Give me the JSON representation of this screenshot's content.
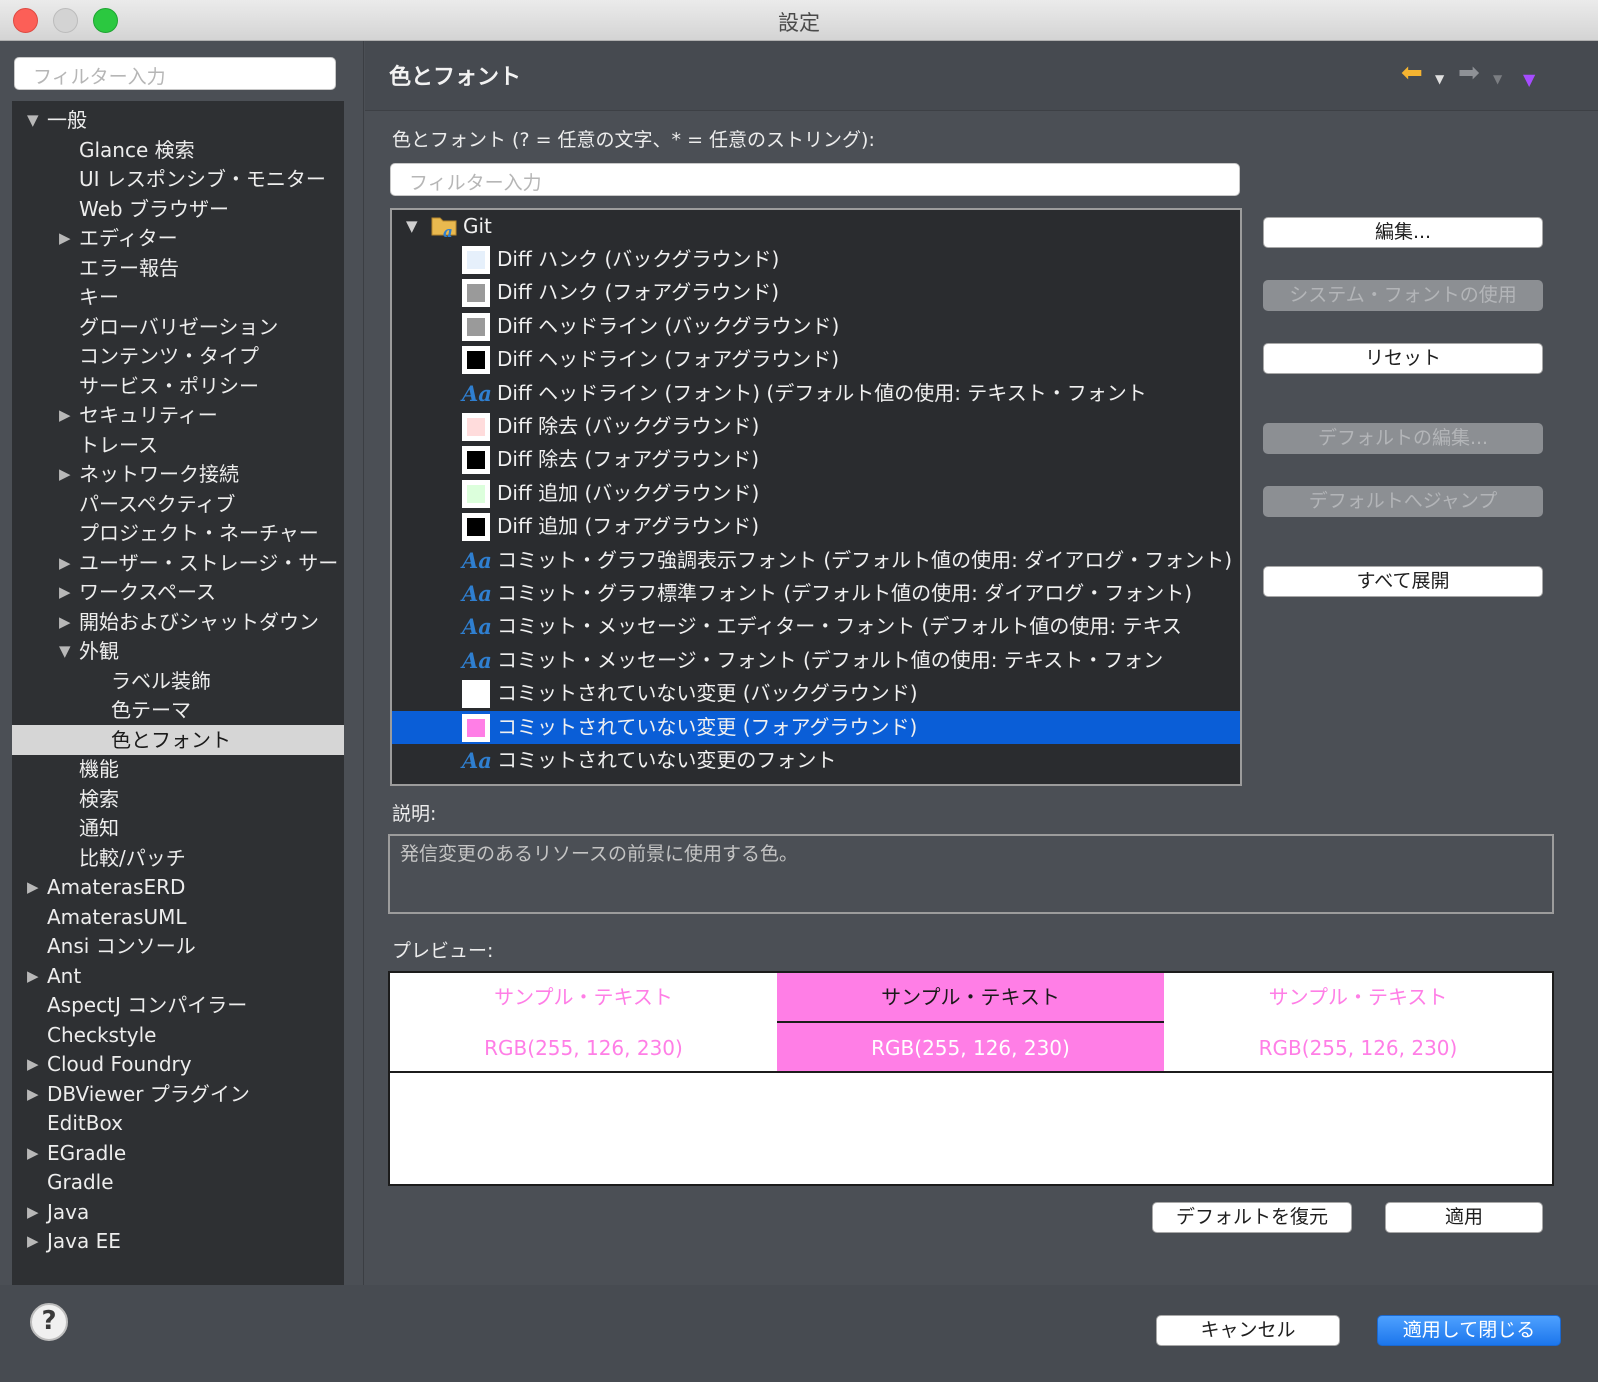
{
  "window": {
    "title": "設定"
  },
  "left": {
    "filter_placeholder": "フィルター入力",
    "tree": [
      {
        "label": "一般",
        "depth": 0,
        "expanded": true
      },
      {
        "label": "Glance 検索",
        "depth": 1
      },
      {
        "label": "UI レスポンシブ・モニター",
        "depth": 1
      },
      {
        "label": "Web ブラウザー",
        "depth": 1
      },
      {
        "label": "エディター",
        "depth": 1,
        "collapsed": true
      },
      {
        "label": "エラー報告",
        "depth": 1
      },
      {
        "label": "キー",
        "depth": 1
      },
      {
        "label": "グローバリゼーション",
        "depth": 1
      },
      {
        "label": "コンテンツ・タイプ",
        "depth": 1
      },
      {
        "label": "サービス・ポリシー",
        "depth": 1
      },
      {
        "label": "セキュリティー",
        "depth": 1,
        "collapsed": true
      },
      {
        "label": "トレース",
        "depth": 1
      },
      {
        "label": "ネットワーク接続",
        "depth": 1,
        "collapsed": true
      },
      {
        "label": "パースペクティブ",
        "depth": 1
      },
      {
        "label": "プロジェクト・ネーチャー",
        "depth": 1
      },
      {
        "label": "ユーザー・ストレージ・サー",
        "depth": 1,
        "collapsed": true
      },
      {
        "label": "ワークスペース",
        "depth": 1,
        "collapsed": true
      },
      {
        "label": "開始およびシャットダウン",
        "depth": 1,
        "collapsed": true
      },
      {
        "label": "外観",
        "depth": 1,
        "expanded": true
      },
      {
        "label": "ラベル装飾",
        "depth": 2
      },
      {
        "label": "色テーマ",
        "depth": 2
      },
      {
        "label": "色とフォント",
        "depth": 2,
        "selected": true
      },
      {
        "label": "機能",
        "depth": 1
      },
      {
        "label": "検索",
        "depth": 1
      },
      {
        "label": "通知",
        "depth": 1
      },
      {
        "label": "比較/パッチ",
        "depth": 1
      },
      {
        "label": "AmaterasERD",
        "depth": 0,
        "collapsed": true
      },
      {
        "label": "AmaterasUML",
        "depth": 0
      },
      {
        "label": "Ansi コンソール",
        "depth": 0
      },
      {
        "label": "Ant",
        "depth": 0,
        "collapsed": true
      },
      {
        "label": "AspectJ コンパイラー",
        "depth": 0
      },
      {
        "label": "Checkstyle",
        "depth": 0
      },
      {
        "label": "Cloud Foundry",
        "depth": 0,
        "collapsed": true
      },
      {
        "label": "DBViewer プラグイン",
        "depth": 0,
        "collapsed": true
      },
      {
        "label": "EditBox",
        "depth": 0
      },
      {
        "label": "EGradle",
        "depth": 0,
        "collapsed": true
      },
      {
        "label": "Gradle",
        "depth": 0
      },
      {
        "label": "Java",
        "depth": 0,
        "collapsed": true
      },
      {
        "label": "Java EE",
        "depth": 0,
        "collapsed": true
      }
    ]
  },
  "right": {
    "title": "色とフォント",
    "list_label": "色とフォント (? = 任意の文字、* = 任意のストリング):",
    "filter_placeholder": "フィルター入力",
    "group": "Git",
    "rows": [
      {
        "kind": "color",
        "color": "#e6f0fb",
        "label": "Diff ハンク (バックグラウンド)"
      },
      {
        "kind": "color",
        "color": "#9a9a9a",
        "label": "Diff ハンク (フォアグラウンド)"
      },
      {
        "kind": "color",
        "color": "#9a9a9a",
        "label": "Diff ヘッドライン (バックグラウンド)"
      },
      {
        "kind": "color",
        "color": "#000000",
        "label": "Diff ヘッドライン (フォアグラウンド)"
      },
      {
        "kind": "font",
        "label": "Diff ヘッドライン (フォント) (デフォルト値の使用: テキスト・フォント"
      },
      {
        "kind": "color",
        "color": "#ffdcdc",
        "label": "Diff 除去 (バックグラウンド)"
      },
      {
        "kind": "color",
        "color": "#000000",
        "label": "Diff 除去 (フォアグラウンド)"
      },
      {
        "kind": "color",
        "color": "#dcffdc",
        "label": "Diff 追加 (バックグラウンド)"
      },
      {
        "kind": "color",
        "color": "#000000",
        "label": "Diff 追加 (フォアグラウンド)"
      },
      {
        "kind": "font",
        "label": "コミット・グラフ強調表示フォント (デフォルト値の使用: ダイアログ・フォント)"
      },
      {
        "kind": "font",
        "label": "コミット・グラフ標準フォント (デフォルト値の使用: ダイアログ・フォント)"
      },
      {
        "kind": "font",
        "label": "コミット・メッセージ・エディター・フォント (デフォルト値の使用: テキス"
      },
      {
        "kind": "font",
        "label": "コミット・メッセージ・フォント (デフォルト値の使用: テキスト・フォン"
      },
      {
        "kind": "color",
        "color": "#ffffff",
        "label": "コミットされていない変更 (バックグラウンド)"
      },
      {
        "kind": "color",
        "color": "#ff7ee6",
        "label": "コミットされていない変更 (フォアグラウンド)",
        "selected": true
      },
      {
        "kind": "font",
        "label": "コミットされていない変更のフォント"
      }
    ],
    "buttons": {
      "edit": "編集...",
      "system_font": "システム・フォントの使用",
      "reset": "リセット",
      "edit_default": "デフォルトの編集...",
      "goto_default": "デフォルトへジャンプ",
      "expand_all": "すべて展開",
      "restore_defaults": "デフォルトを復元",
      "apply": "適用"
    },
    "description_label": "説明:",
    "description": "発信変更のあるリソースの前景に使用する色。",
    "preview_label": "プレビュー:",
    "preview": {
      "sample": "サンプル・テキスト",
      "rgb": "RGB(255, 126, 230)",
      "accent": "#ff7ee6"
    }
  },
  "footer": {
    "help": "?",
    "cancel": "キャンセル",
    "apply_close": "適用して閉じる"
  },
  "colors": {
    "selection": "#0a5ed7",
    "list_bg": "#2a2c2f",
    "panel_bg": "#4b4f55"
  }
}
